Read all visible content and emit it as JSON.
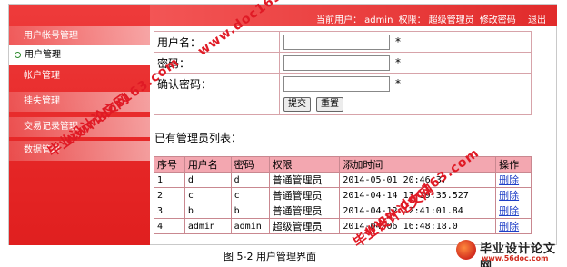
{
  "topbar": {
    "current_user_label": "当前用户：",
    "current_user": "admin",
    "permission_label": "权限：",
    "permission": "超级管理员",
    "change_password": "修改密码",
    "logout": "退出"
  },
  "sidebar": {
    "items": [
      {
        "label": "用户帐号管理",
        "active": false
      },
      {
        "label": "用户管理",
        "active": true
      },
      {
        "label": "帐户管理",
        "active": false
      },
      {
        "label": "挂失管理",
        "active": false
      },
      {
        "label": "交易记录管理",
        "active": false
      },
      {
        "label": "数据管理",
        "active": false
      }
    ]
  },
  "form": {
    "username_label": "用户名：",
    "password_label": "密码：",
    "confirm_label": "确认密码：",
    "required_mark": "*",
    "submit_label": "提交",
    "reset_label": "重置"
  },
  "list": {
    "title": "已有管理员列表：",
    "headers": [
      "序号",
      "用户名",
      "密码",
      "权限",
      "添加时间",
      "操作"
    ],
    "rows": [
      [
        "1",
        "d",
        "d",
        "普通管理员",
        "2014-05-01 20:46.37",
        "删除"
      ],
      [
        "2",
        "c",
        "c",
        "普通管理员",
        "2014-04-14 13:39:35.527",
        "删除"
      ],
      [
        "3",
        "b",
        "b",
        "普通管理员",
        "2014-04-12 12:41:01.84",
        "删除"
      ],
      [
        "4",
        "admin",
        "admin",
        "超级管理员",
        "2014-04-06 16:48:18.0",
        "删除"
      ]
    ]
  },
  "caption": "图 5-2 用户管理界面",
  "watermarks": {
    "cn": "毕业设计论文网",
    "url": "www.doc163.com"
  },
  "logo": {
    "main": "毕业设计论文网",
    "sub": "www.56doc.com"
  },
  "colors": {
    "sidebar_red": "#e62727",
    "header_red": "#e12b2b",
    "table_header_pink": "#f3a7b0",
    "link_blue": "#1f3fc6"
  }
}
